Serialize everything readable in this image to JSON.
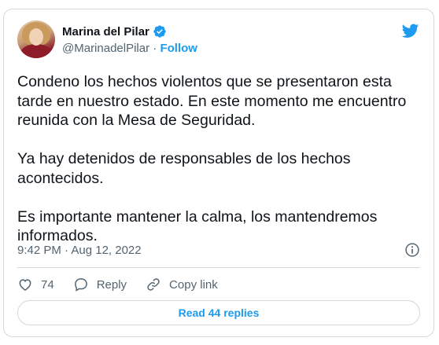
{
  "tweet": {
    "author_name": "Marina del Pilar",
    "handle": "@MarinadelPilar",
    "separator": "·",
    "follow_label": "Follow",
    "paragraphs": [
      "Condeno los hechos violentos que se presentaron esta tarde en nuestro estado. En este momento me encuentro reunida con la Mesa de Seguridad.",
      "Ya hay detenidos de responsables de los hechos acontecidos.",
      "Es importante mantener la calma, los mantendremos informados."
    ],
    "timestamp": "9:42 PM · Aug 12, 2022",
    "likes": "74",
    "reply_label": "Reply",
    "copy_link_label": "Copy link",
    "read_replies_label": "Read 44 replies"
  },
  "icons": {
    "verified": "verified-badge-icon",
    "brand": "twitter-bird-icon",
    "info": "info-icon",
    "like": "heart-icon",
    "reply": "speech-bubble-icon",
    "copy_link": "link-icon"
  },
  "colors": {
    "accent": "#1d9bf0",
    "text": "#0f1419",
    "secondary": "#536471",
    "border": "#cfd9de"
  }
}
